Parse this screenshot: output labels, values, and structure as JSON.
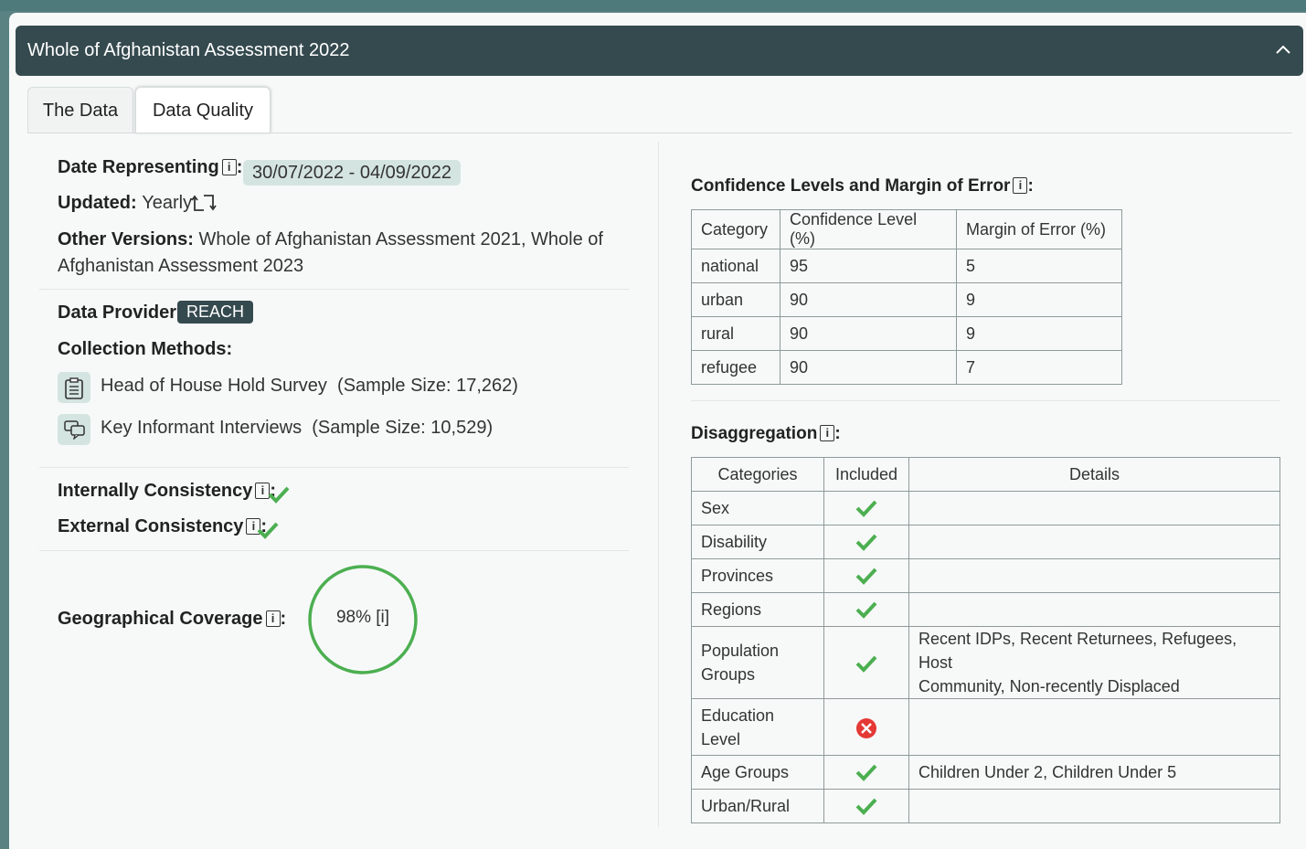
{
  "header": {
    "title": "Whole of Afghanistan Assessment 2022"
  },
  "tabs": [
    "The Data",
    "Data Quality"
  ],
  "left": {
    "date_label": "Date Representing",
    "date_value": "30/07/2022 - 04/09/2022",
    "updated_label": "Updated:",
    "updated_value": "Yearly",
    "other_label": "Other Versions:",
    "other_line1": "Whole of Afghanistan Assessment 2021, Whole of",
    "other_line2": "Afghanistan Assessment 2023",
    "provider_label": "Data Provider:",
    "provider_value": "REACH",
    "methods_label": "Collection Methods:",
    "methods": [
      {
        "name": "Head of House Hold Survey",
        "sample": "(Sample Size: 17,262)"
      },
      {
        "name": "Key Informant Interviews",
        "sample": "(Sample Size: 10,529)"
      }
    ],
    "internal_label": "Internally Consistency",
    "external_label": "External Consistency",
    "geo_label": "Geographical Coverage",
    "geo_value": "98% [i]",
    "info_glyph": "i",
    "colon": ":"
  },
  "confidence": {
    "title": "Confidence Levels and Margin of Error",
    "headers": [
      "Category",
      "Confidence Level (%)",
      "Margin of Error (%)"
    ],
    "rows": [
      [
        "national",
        "95",
        "5"
      ],
      [
        "urban",
        "90",
        "9"
      ],
      [
        "rural",
        "90",
        "9"
      ],
      [
        "refugee",
        "90",
        "7"
      ]
    ]
  },
  "disaggregation": {
    "title": "Disaggregation",
    "headers": [
      "Categories",
      "Included",
      "Details"
    ],
    "rows": [
      {
        "cat1": "Sex",
        "cat2": "",
        "included": true,
        "d1": "",
        "d2": ""
      },
      {
        "cat1": "Disability",
        "cat2": "",
        "included": true,
        "d1": "",
        "d2": ""
      },
      {
        "cat1": "Provinces",
        "cat2": "",
        "included": true,
        "d1": "",
        "d2": ""
      },
      {
        "cat1": "Regions",
        "cat2": "",
        "included": true,
        "d1": "",
        "d2": ""
      },
      {
        "cat1": "Population",
        "cat2": "Groups",
        "included": true,
        "d1": "Recent IDPs, Recent Returnees, Refugees, Host",
        "d2": "Community, Non-recently Displaced"
      },
      {
        "cat1": "Education",
        "cat2": "Level",
        "included": false,
        "d1": "",
        "d2": ""
      },
      {
        "cat1": "Age Groups",
        "cat2": "",
        "included": true,
        "d1": "Children Under 2, Children Under 5",
        "d2": ""
      },
      {
        "cat1": "Urban/Rural",
        "cat2": "",
        "included": true,
        "d1": "",
        "d2": ""
      }
    ]
  },
  "colors": {
    "header_bg": "#354a4f",
    "accent": "#d4e4e1",
    "check": "#4caf50",
    "cross": "#e53935",
    "coverage_ring": "#4caf50"
  },
  "icons": [
    "chevron-up-icon",
    "info-icon",
    "update-arrows-icon",
    "clipboard-icon",
    "chat-icon",
    "check-icon",
    "cross-icon"
  ]
}
